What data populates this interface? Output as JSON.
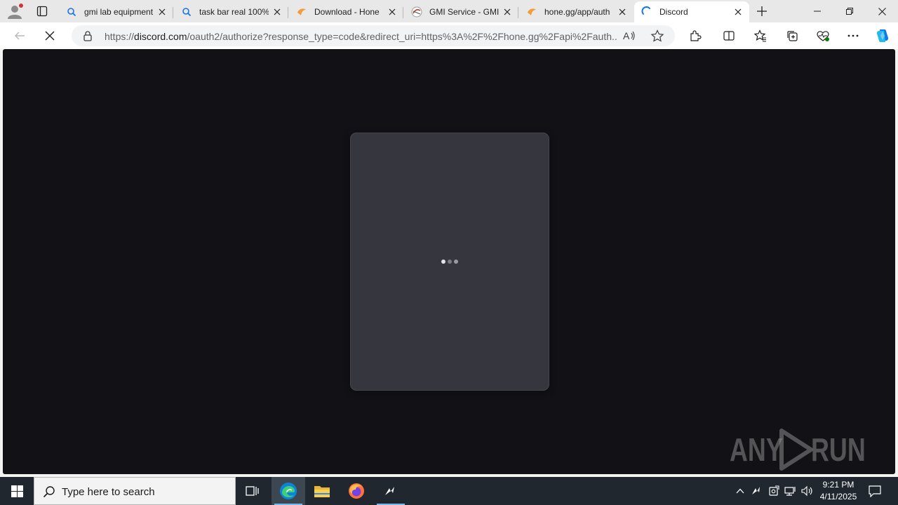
{
  "browser": {
    "tabs": [
      {
        "title": "gmi lab equipment",
        "favicon": "search-icon"
      },
      {
        "title": "task bar real 100%",
        "favicon": "search-icon"
      },
      {
        "title": "Download - Hone",
        "favicon": "hone-icon"
      },
      {
        "title": "GMI Service - GMI",
        "favicon": "gmi-icon"
      },
      {
        "title": "hone.gg/app/auth",
        "favicon": "hone-icon"
      },
      {
        "title": "Discord",
        "favicon": "loading-spinner-icon",
        "active": true
      }
    ],
    "url": {
      "scheme": "https://",
      "host": "discord.com",
      "path": "/oauth2/authorize?response_type=code&redirect_uri=https%3A%2F%2Fhone.gg%2Fapi%2Fauth..."
    }
  },
  "page": {
    "loading_indicator": {
      "dot_count": 3
    },
    "watermark": {
      "left": "ANY",
      "right": "RUN"
    }
  },
  "taskbar": {
    "search_placeholder": "Type here to search",
    "apps": [
      "task-view-icon",
      "edge-icon",
      "file-explorer-icon",
      "firefox-icon",
      "hone-app-icon"
    ],
    "clock": {
      "time": "9:21 PM",
      "date": "4/11/2025"
    }
  },
  "colors": {
    "page_bg": "#111116",
    "card_bg": "#36363e",
    "taskbar_bg": "#20272f",
    "accent": "#0078d4"
  }
}
